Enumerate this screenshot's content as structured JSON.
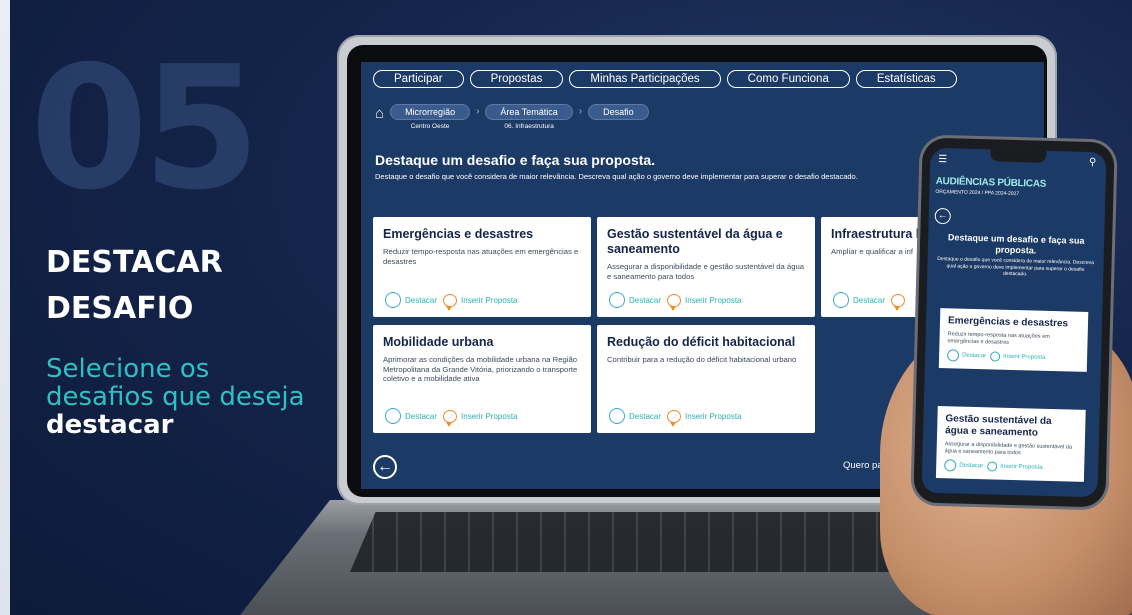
{
  "slide": {
    "number": "05",
    "title_line1": "DESTACAR",
    "title_line2": "DESAFIO",
    "subtitle_plain": "Selecione os desafios que deseja",
    "subtitle_bold": "destacar"
  },
  "nav": [
    "Participar",
    "Propostas",
    "Minhas Participações",
    "Como Funciona",
    "Estatísticas"
  ],
  "breadcrumb": [
    {
      "label": "Microrregião",
      "sub": "Centro Oeste"
    },
    {
      "label": "Área Temática",
      "sub": "06. Infraestrutura"
    },
    {
      "label": "Desafio",
      "sub": ""
    }
  ],
  "page": {
    "heading": "Destaque um desafio e faça sua proposta.",
    "description": "Destaque o desafio que você considera de maior relevância. Descreva qual ação o governo deve implementar para superar o desafio destacado."
  },
  "cards": [
    {
      "title": "Emergências e desastres",
      "desc": "Reduzir tempo-resposta nas atuações em emergências e desastres"
    },
    {
      "title": "Gestão sustentável da água e saneamento",
      "desc": "Assegurar a disponibilidade e gestão sustentável da água e saneamento para todos"
    },
    {
      "title": "Infraestrutura lo",
      "desc": "Ampliar e qualificar a inf"
    },
    {
      "title": "Mobilidade urbana",
      "desc": "Aprimorar as condições da mobilidade urbana na Região Metropolitana da Grande Vitória, priorizando o transporte coletivo e a mobilidade ativa"
    },
    {
      "title": "Redução do déficit habitacional",
      "desc": "Contribuir para a redução do déficit habitacional urbano"
    }
  ],
  "actions": {
    "highlight": "Destacar",
    "propose": "Inserir Proposta"
  },
  "footer": {
    "back_icon": "arrow-left-circle",
    "cta": "Quero partic"
  },
  "phone": {
    "brand": "AUDIÊNCIAS PÚBLICAS",
    "brand_sub": "ORÇAMENTO 2024 / PPA 2024-2027",
    "heading": "Destaque um desafio e faça sua proposta.",
    "description": "Destaque o desafio que você considera de maior relevância. Descreva qual ação o governo deve implementar para superar o desafio destacado.",
    "cards": [
      {
        "title": "Emergências e desastres",
        "desc": "Reduzir tempo-resposta nas atuações em emergências e desastres"
      },
      {
        "title": "Gestão sustentável da água e saneamento",
        "desc": "Assegurar a disponibilidade e gestão sustentável da água e saneamento para todos"
      }
    ],
    "highlight": "Destacar",
    "propose": "Inserir Proposta"
  },
  "colors": {
    "navy": "#1c3a66",
    "teal": "#2fc0c4",
    "orange": "#f08a24"
  }
}
